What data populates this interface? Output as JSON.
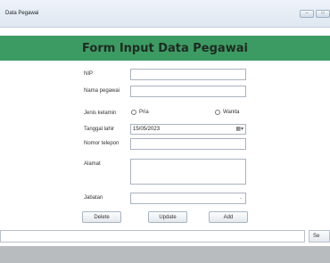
{
  "window": {
    "title": "Data Pegawai",
    "controls": {
      "minimize": "–",
      "maximize": "□"
    }
  },
  "form": {
    "title": "Form Input Data Pegawai",
    "fields": {
      "nip": {
        "label": "NIP",
        "value": ""
      },
      "nama": {
        "label": "Nama pegawai",
        "value": ""
      },
      "jenis_kelamin": {
        "label": "Jenis kelamin",
        "options": [
          "Pria",
          "Wanita"
        ],
        "selected": null
      },
      "tanggal_lahir": {
        "label": "Tanggal lahir",
        "value": "15/05/2023",
        "icon": "calendar-dropdown-icon"
      },
      "telepon": {
        "label": "Nomor telepon",
        "value": ""
      },
      "alamat": {
        "label": "Alamat",
        "value": ""
      },
      "jabatan": {
        "label": "Jabatan",
        "value": "",
        "icon": "chevron-down-icon"
      }
    },
    "buttons": {
      "delete": "Delete",
      "update": "Update",
      "add": "Add"
    }
  },
  "footer": {
    "search_value": "",
    "button_label": "Se"
  },
  "colors": {
    "header": "#3c9b62",
    "titlebar": "#dfe7f1",
    "bottom_bar": "#b9bcbf"
  }
}
